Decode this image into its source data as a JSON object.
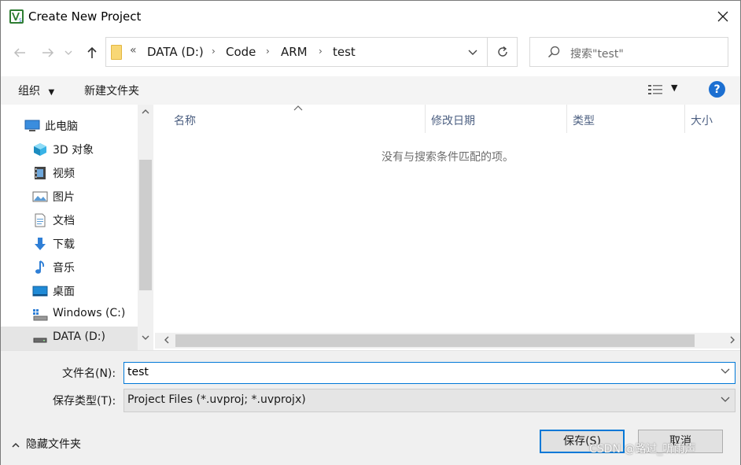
{
  "window": {
    "title": "Create New Project",
    "app_icon": "keil-uvision-icon"
  },
  "address": {
    "overflow": "«",
    "crumbs": [
      "DATA (D:)",
      "Code",
      "ARM",
      "test"
    ]
  },
  "search": {
    "placeholder": "搜索\"test\""
  },
  "commandbar": {
    "organize": "组织",
    "new_folder": "新建文件夹",
    "help": "?"
  },
  "nav": {
    "items": [
      {
        "label": "此电脑",
        "icon": "computer-icon"
      },
      {
        "label": "3D 对象",
        "icon": "3d-objects-icon"
      },
      {
        "label": "视频",
        "icon": "video-icon"
      },
      {
        "label": "图片",
        "icon": "pictures-icon"
      },
      {
        "label": "文档",
        "icon": "documents-icon"
      },
      {
        "label": "下载",
        "icon": "download-icon"
      },
      {
        "label": "音乐",
        "icon": "music-icon"
      },
      {
        "label": "桌面",
        "icon": "desktop-icon"
      },
      {
        "label": "Windows (C:)",
        "icon": "drive-c-icon"
      },
      {
        "label": "DATA (D:)",
        "icon": "drive-d-icon"
      }
    ]
  },
  "list": {
    "columns": [
      "名称",
      "修改日期",
      "类型",
      "大小"
    ],
    "empty_message": "没有与搜索条件匹配的项。"
  },
  "form": {
    "filename_label": "文件名(N):",
    "filename_value": "test",
    "filetype_label": "保存类型(T):",
    "filetype_value": "Project Files (*.uvproj; *.uvprojx)",
    "hide_folders": "隐藏文件夹",
    "save": "保存(S)",
    "cancel": "取消"
  },
  "watermark": "CSDN @路过_听雨声",
  "colors": {
    "accent": "#0078d7",
    "selection": "#cce8ff",
    "help": "#1c6fd1"
  }
}
